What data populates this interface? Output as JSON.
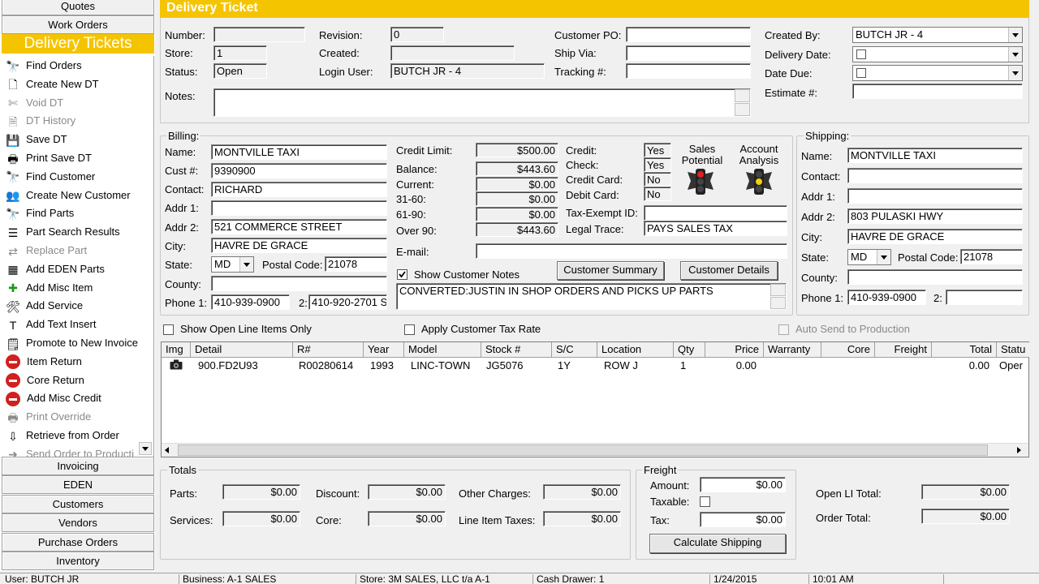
{
  "sidebar": {
    "top_tabs": [
      "Quotes",
      "Work Orders"
    ],
    "active_module": "Delivery Tickets",
    "items": [
      {
        "label": "Find Orders",
        "icon": "binoculars-icon",
        "enabled": true
      },
      {
        "label": "Create New DT",
        "icon": "new-document-icon",
        "enabled": true
      },
      {
        "label": "Void DT",
        "icon": "void-icon",
        "enabled": false
      },
      {
        "label": "DT History",
        "icon": "history-icon",
        "enabled": false
      },
      {
        "label": "Save DT",
        "icon": "floppy-disk-icon",
        "enabled": true
      },
      {
        "label": "Print  Save DT",
        "icon": "printer-icon",
        "enabled": true
      },
      {
        "label": "Find Customer",
        "icon": "binoculars-icon",
        "enabled": true
      },
      {
        "label": "Create New Customer",
        "icon": "new-customer-icon",
        "enabled": true
      },
      {
        "label": "Find Parts",
        "icon": "binoculars-icon",
        "enabled": true
      },
      {
        "label": "Part Search Results",
        "icon": "search-results-icon",
        "enabled": true
      },
      {
        "label": "Replace Part",
        "icon": "replace-icon",
        "enabled": false
      },
      {
        "label": "Add EDEN Parts",
        "icon": "eden-icon",
        "enabled": true
      },
      {
        "label": "Add Misc Item",
        "icon": "plus-icon",
        "enabled": true
      },
      {
        "label": "Add Service",
        "icon": "service-person-icon",
        "enabled": true
      },
      {
        "label": "Add Text Insert",
        "icon": "text-only-icon",
        "enabled": true
      },
      {
        "label": "Promote to New Invoice",
        "icon": "invoice-icon",
        "enabled": true
      },
      {
        "label": "Item Return",
        "icon": "minus-circle-icon",
        "enabled": true
      },
      {
        "label": "Core Return",
        "icon": "minus-circle-icon",
        "enabled": true
      },
      {
        "label": "Add Misc Credit",
        "icon": "minus-circle-icon",
        "enabled": true
      },
      {
        "label": "Print Override",
        "icon": "printer-icon",
        "enabled": false
      },
      {
        "label": "Retrieve from Order",
        "icon": "retrieve-icon",
        "enabled": true
      },
      {
        "label": "Send Order to Producti",
        "icon": "send-icon",
        "enabled": false
      }
    ],
    "bottom_tabs": [
      "Invoicing",
      "EDEN",
      "Customers",
      "Vendors",
      "Purchase Orders",
      "Inventory"
    ]
  },
  "header": {
    "title": "Delivery Ticket",
    "number_label": "Number:",
    "number_value": "",
    "store_label": "Store:",
    "store_value": "1",
    "status_label": "Status:",
    "status_value": "Open",
    "revision_label": "Revision:",
    "revision_value": "0",
    "created_label": "Created:",
    "created_value": "",
    "login_user_label": "Login User:",
    "login_user_value": "BUTCH JR - 4",
    "customer_po_label": "Customer PO:",
    "customer_po_value": "",
    "ship_via_label": "Ship Via:",
    "ship_via_value": "",
    "tracking_label": "Tracking #:",
    "tracking_value": "",
    "created_by_label": "Created By:",
    "created_by_value": "BUTCH JR - 4",
    "delivery_date_label": "Delivery Date:",
    "date_due_label": "Date Due:",
    "estimate_label": "Estimate #:",
    "estimate_value": "",
    "notes_label": "Notes:",
    "notes_value": ""
  },
  "billing": {
    "title": "Billing:",
    "name_label": "Name:",
    "name": "MONTVILLE TAXI",
    "cust_label": "Cust #:",
    "cust": "9390900",
    "contact_label": "Contact:",
    "contact": "RICHARD",
    "addr1_label": "Addr 1:",
    "addr1": "",
    "addr2_label": "Addr 2:",
    "addr2": "521 COMMERCE STREET",
    "city_label": "City:",
    "city": "HAVRE DE GRACE",
    "state_label": "State:",
    "state": "MD",
    "postal_label": "Postal Code:",
    "postal": "21078",
    "county_label": "County:",
    "county": "",
    "phone_label": "Phone 1:",
    "phone1": "410-939-0900",
    "phone2_label": "2:",
    "phone2": "410-920-2701 S"
  },
  "credit": {
    "limit_label": "Credit Limit:",
    "limit": "$500.00",
    "balance_label": "Balance:",
    "balance": "$443.60",
    "current_label": "Current:",
    "current": "$0.00",
    "d31_label": "31-60:",
    "d31": "$0.00",
    "d61_label": "61-90:",
    "d61": "$0.00",
    "over90_label": "Over 90:",
    "over90": "$443.60",
    "email_label": "E-mail:",
    "email": "",
    "credit_label": "Credit:",
    "credit": "Yes",
    "check_label": "Check:",
    "check": "Yes",
    "credit_card_label": "Credit Card:",
    "credit_card": "No",
    "debit_card_label": "Debit Card:",
    "debit_card": "No",
    "tax_exempt_label": "Tax-Exempt ID:",
    "tax_exempt": "",
    "legal_trace_label": "Legal Trace:",
    "legal_trace": "PAYS SALES TAX",
    "sales_potential_label": "Sales\nPotential",
    "account_analysis_label": "Account\nAnalysis",
    "show_notes_label": "Show Customer Notes",
    "customer_summary_btn": "Customer Summary",
    "customer_details_btn": "Customer Details",
    "customer_notes": "CONVERTED:JUSTIN IN SHOP ORDERS AND PICKS UP PARTS"
  },
  "shipping": {
    "title": "Shipping:",
    "name_label": "Name:",
    "name": "MONTVILLE TAXI",
    "contact_label": "Contact:",
    "contact": "",
    "addr1_label": "Addr 1:",
    "addr1": "",
    "addr2_label": "Addr 2:",
    "addr2": "803 PULASKI HWY",
    "city_label": "City:",
    "city": "HAVRE DE GRACE",
    "state_label": "State:",
    "state": "MD",
    "postal_label": "Postal Code:",
    "postal": "21078",
    "county_label": "County:",
    "county": "",
    "phone_label": "Phone 1:",
    "phone1": "410-939-0900",
    "phone2_label": "2:",
    "phone2": ""
  },
  "options": {
    "show_open_label": "Show Open Line Items Only",
    "apply_tax_label": "Apply Customer Tax Rate",
    "auto_send_label": "Auto Send to Production"
  },
  "grid": {
    "columns": [
      "Img",
      "Detail",
      "R#",
      "Year",
      "Model",
      "Stock #",
      "S/C",
      "Location",
      "Qty",
      "Price",
      "Warranty",
      "Core",
      "Freight",
      "Total",
      "Statu"
    ],
    "rows": [
      {
        "detail": "900.FD2U93",
        "r": "R00280614",
        "year": "1993",
        "model": "LINC-TOWN",
        "stock": "JG5076",
        "sc": "1Y",
        "location": "ROW J",
        "qty": "1",
        "price": "0.00",
        "total": "0.00",
        "status": "Oper"
      }
    ]
  },
  "totals": {
    "title": "Totals",
    "parts_label": "Parts:",
    "parts": "$0.00",
    "services_label": "Services:",
    "services": "$0.00",
    "discount_label": "Discount:",
    "discount": "$0.00",
    "core_label": "Core:",
    "core": "$0.00",
    "other_label": "Other Charges:",
    "other": "$0.00",
    "line_tax_label": "Line Item Taxes:",
    "line_tax": "$0.00"
  },
  "freight": {
    "title": "Freight",
    "amount_label": "Amount:",
    "amount": "$0.00",
    "taxable_label": "Taxable:",
    "tax_label": "Tax:",
    "tax": "$0.00",
    "calc_btn": "Calculate Shipping"
  },
  "summary": {
    "open_li_label": "Open LI Total:",
    "open_li": "$0.00",
    "order_total_label": "Order Total:",
    "order_total": "$0.00"
  },
  "statusbar": {
    "user": "User: BUTCH JR",
    "business": "Business: A-1 SALES",
    "store": "Store: 3M SALES, LLC   t/a  A-1",
    "drawer": "Cash Drawer: 1",
    "date": "1/24/2015",
    "time": "10:01 AM"
  },
  "colors": {
    "accent": "#f5c400"
  }
}
